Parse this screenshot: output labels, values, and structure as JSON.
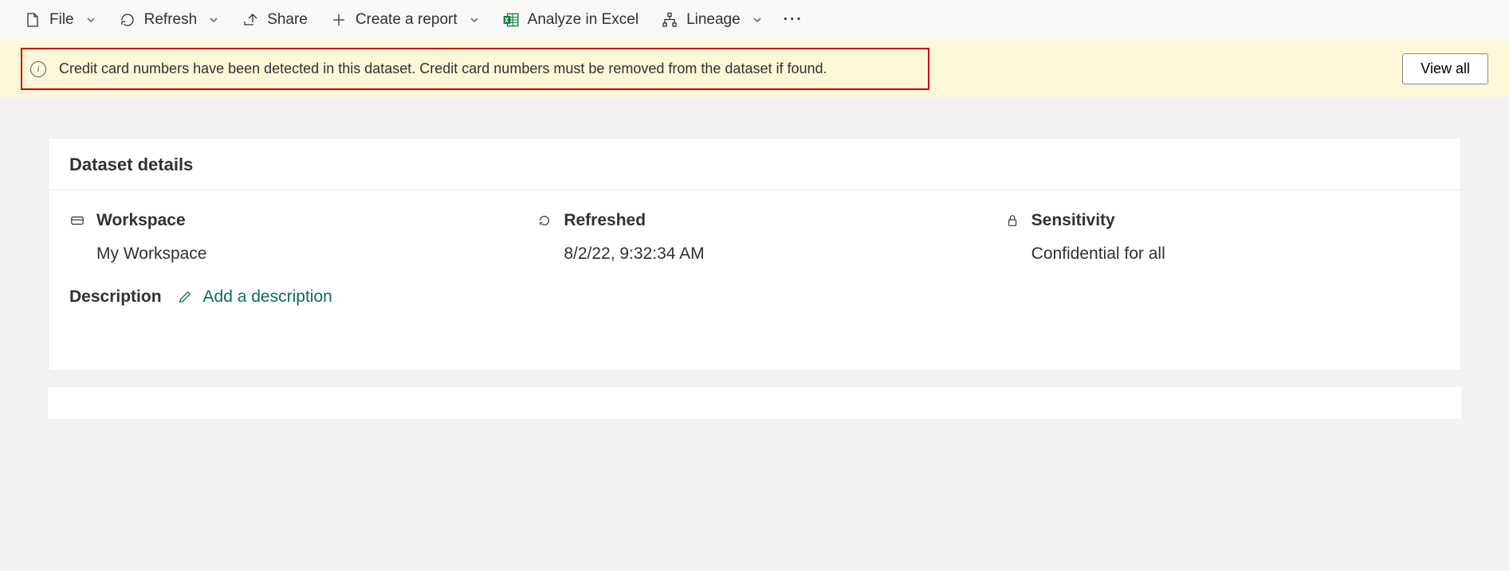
{
  "toolbar": {
    "file_label": "File",
    "refresh_label": "Refresh",
    "share_label": "Share",
    "create_report_label": "Create a report",
    "analyze_excel_label": "Analyze in Excel",
    "lineage_label": "Lineage"
  },
  "notification": {
    "message": "Credit card numbers have been detected in this dataset. Credit card numbers must be removed from the dataset if found.",
    "view_all_label": "View all"
  },
  "details": {
    "title": "Dataset details",
    "workspace_label": "Workspace",
    "workspace_value": "My Workspace",
    "refreshed_label": "Refreshed",
    "refreshed_value": "8/2/22, 9:32:34 AM",
    "sensitivity_label": "Sensitivity",
    "sensitivity_value": "Confidential for all",
    "description_label": "Description",
    "add_description_label": "Add a description"
  }
}
